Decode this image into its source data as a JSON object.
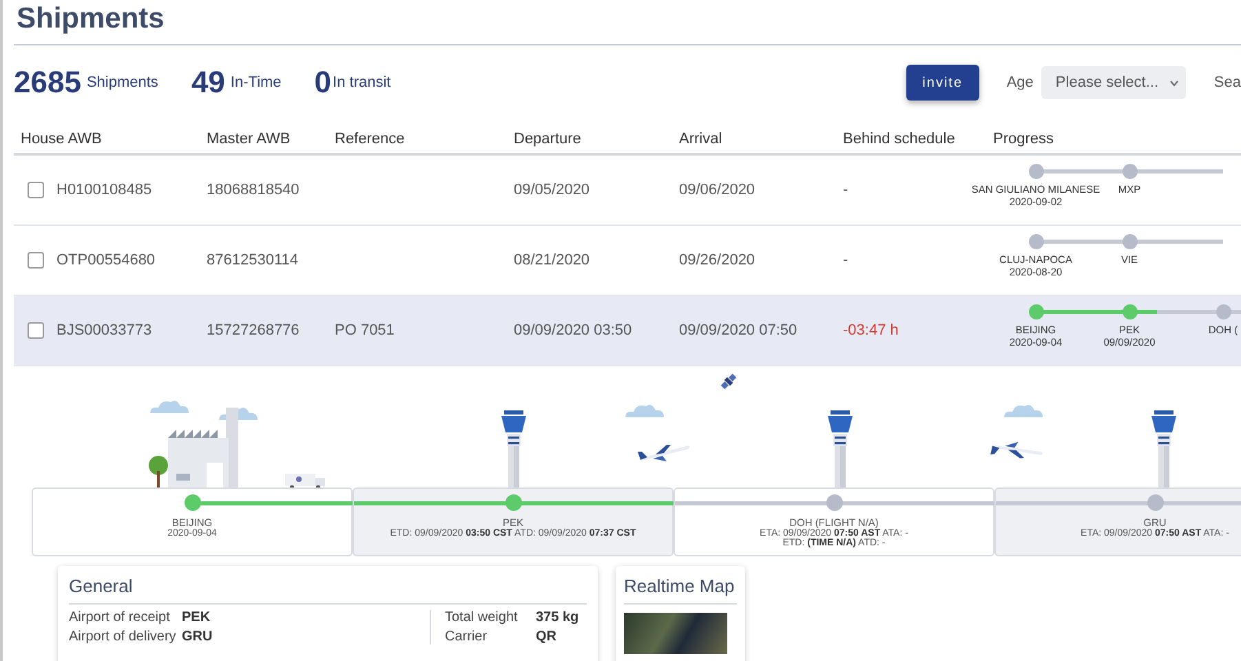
{
  "page": {
    "title": "Shipments"
  },
  "stats": [
    {
      "value": "2685",
      "label": "Shipments"
    },
    {
      "value": "49",
      "label": "In-Time"
    },
    {
      "value": "0",
      "label": "In transit"
    }
  ],
  "toolbar": {
    "invite_button": "invite",
    "age_label": "Age",
    "age_select": {
      "placeholder": "Please select..."
    },
    "search_label": "Sea"
  },
  "table": {
    "columns": [
      "House AWB",
      "Master AWB",
      "Reference",
      "Departure",
      "Arrival",
      "Behind schedule",
      "Progress"
    ],
    "rows": [
      {
        "house_awb": "H0100108485",
        "master_awb": "18068818540",
        "reference": "",
        "departure": "09/05/2020",
        "arrival": "09/06/2020",
        "behind_schedule": "-",
        "delayed": false,
        "checked": false,
        "selected": false,
        "progress": [
          {
            "label": "SAN GIULIANO MILANESE",
            "date": "2020-09-02",
            "reached": false,
            "level": 0
          },
          {
            "label": "MXP",
            "reached": false,
            "level": 0
          }
        ]
      },
      {
        "house_awb": "OTP00554680",
        "master_awb": "87612530114",
        "reference": "",
        "departure": "08/21/2020",
        "arrival": "09/26/2020",
        "behind_schedule": "-",
        "delayed": false,
        "checked": false,
        "selected": false,
        "progress": [
          {
            "label": "CLUJ-NAPOCA",
            "date": "2020-08-20",
            "reached": false,
            "level": 0
          },
          {
            "label": "VIE",
            "reached": false,
            "level": 0
          }
        ]
      },
      {
        "house_awb": "BJS00033773",
        "master_awb": "15727268776",
        "reference": "PO 7051",
        "departure": "09/09/2020 03:50",
        "arrival": "09/09/2020 07:50",
        "behind_schedule": "-03:47 h",
        "delayed": true,
        "checked": false,
        "selected": true,
        "progress": [
          {
            "label": "BEIJING",
            "date": "2020-09-04",
            "reached": true,
            "level": 1
          },
          {
            "label": "PEK",
            "date": "09/09/2020",
            "reached": true,
            "level": 0.3
          },
          {
            "label": "DOH (",
            "reached": false,
            "level": 0
          }
        ]
      }
    ]
  },
  "stages": [
    {
      "name": "BEIJING",
      "lines": [
        "2020-09-04"
      ],
      "reached": true,
      "level": 1
    },
    {
      "name": "PEK",
      "lines": [
        "ETD: 09/09/2020 **03:50 CST** ATD: 09/09/2020 **07:37 CST**"
      ],
      "reached": true,
      "level": 0.53
    },
    {
      "name": "DOH (FLIGHT N/A)",
      "lines": [
        "ETA: 09/09/2020 **07:50 AST** ATA: -",
        "ETD: **(TIME N/A)** ATD: -"
      ],
      "reached": false,
      "level": 0
    },
    {
      "name": "GRU",
      "lines": [
        "ETA: 09/09/2020 **07:50 AST** ATA: -"
      ],
      "reached": false,
      "level": 0
    }
  ],
  "general": {
    "title": "General",
    "left": [
      {
        "label": "Airport of receipt",
        "value": "PEK"
      },
      {
        "label": "Airport of delivery",
        "value": "GRU"
      }
    ],
    "right": [
      {
        "label": "Total weight",
        "value": "375 kg"
      },
      {
        "label": "Carrier",
        "value": "QR"
      }
    ]
  },
  "realtime_map": {
    "title": "Realtime Map"
  }
}
